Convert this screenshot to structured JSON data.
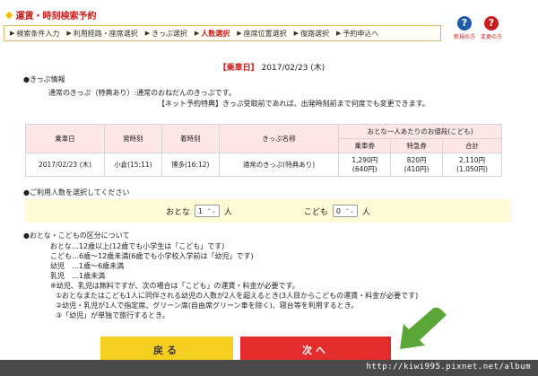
{
  "header": {
    "title": "運賃・時刻検索予約",
    "steps": [
      {
        "label": "検索条件入力",
        "active": false
      },
      {
        "label": "利用経路・座席選択",
        "active": false
      },
      {
        "label": "きっぷ選択",
        "active": false
      },
      {
        "label": "人数選択",
        "active": true
      },
      {
        "label": "座席位置選択",
        "active": false
      },
      {
        "label": "復路選択",
        "active": false
      },
      {
        "label": "予約申込へ",
        "active": false
      }
    ],
    "help_new": "新規の方",
    "help_change": "変更の方",
    "help_symbol": "?"
  },
  "boarding": {
    "label": "【乗車日】",
    "date": "2017/02/23 (木)"
  },
  "ticket_info": {
    "heading": "●きっぷ情報",
    "line1": "通常のきっぷ（特典あり）:通常のおねだんのきっぷです。",
    "line2": "【ネット予約特典】きっぷ受取前であれば、出発時刻前まで何度でも変更できます。"
  },
  "table": {
    "headers": {
      "date": "乗車日",
      "depart": "発時刻",
      "arrive": "着時刻",
      "ticket_name": "きっぷ名称",
      "price_group": "おとな一人あたりのお値段(こども)",
      "fare": "乗車券",
      "express": "特急券",
      "total": "合計"
    },
    "row": {
      "date": "2017/02/23 (木)",
      "depart": "小倉(15:11)",
      "arrive": "博多(16:12)",
      "ticket_name": "通常のきっぷ(特典あり)",
      "fare": "1,290円",
      "fare_child": "(640円)",
      "express": "820円",
      "express_child": "(410円)",
      "total": "2,110円",
      "total_child": "(1,050円)"
    }
  },
  "passengers": {
    "heading": "●ご利用人数を選択してください",
    "adult_label": "おとな",
    "adult_value": "1",
    "child_label": "こども",
    "child_value": "0",
    "unit": "人",
    "chevron": "⌃⌄"
  },
  "notes": {
    "heading": "●おとな・こどもの区分について",
    "lines": [
      "おとな…12歳以上(12歳でも小学生は「こども」です)",
      "こども…6歳～12歳未満(6歳でも小学校入学前は「幼児」です)",
      "幼児　…1歳～6歳未満",
      "乳児　…1歳未満",
      "※幼児、乳児は無料ですが、次の場合は「こども」の運賃・料金が必要です。",
      "①おとなまたはこども1人に同伴される幼児の人数が2人を超えるとき(3人目からこどもの運賃・料金が必要です)",
      "②幼児・乳児が1人で指定席、グリーン席(自由席グリーン車を除く)、寝台等を利用するとき。",
      "③「幼児」が単独で旅行するとき。"
    ]
  },
  "buttons": {
    "back": "戻る",
    "next": "次へ"
  },
  "footer": {
    "url": "http://kiwi995.pixnet.net/album"
  },
  "colors": {
    "accent_red": "#d21a1a",
    "button_yellow": "#f5d021",
    "button_red": "#e32d2d",
    "header_pink": "#fde6e6",
    "box_yellow": "#fffbd6",
    "arrow_green": "#5aa637"
  }
}
